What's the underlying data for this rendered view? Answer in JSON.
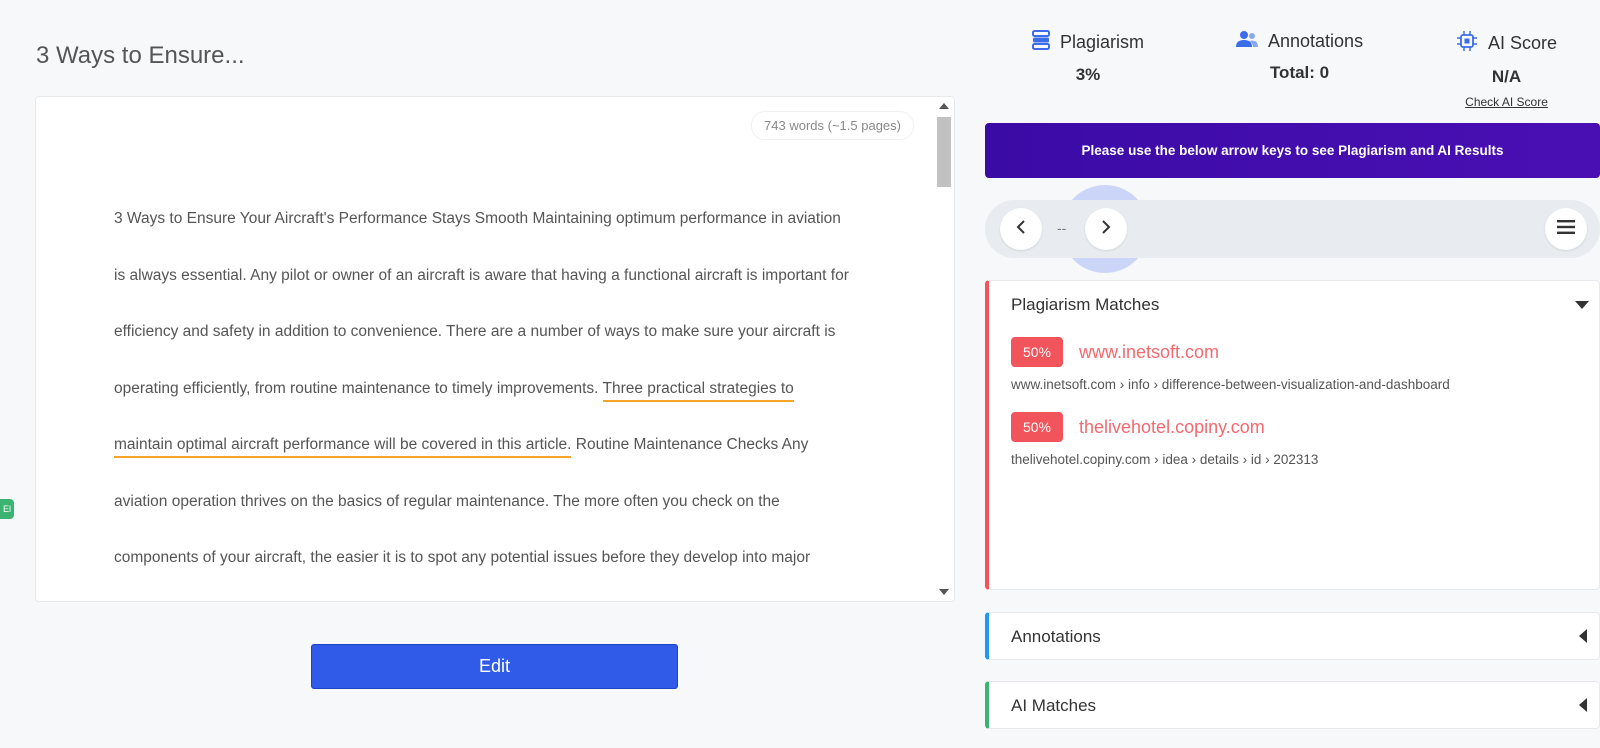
{
  "document": {
    "title": "3 Ways to Ensure...",
    "word_count": "743 words (~1.5 pages)",
    "text_before": "3 Ways to Ensure Your Aircraft's Performance Stays Smooth Maintaining optimum performance in aviation is always essential. Any pilot or owner of an aircraft is aware that having a functional aircraft is important for efficiency and safety in addition to convenience. There are a number of ways to make sure your aircraft is operating efficiently, from routine maintenance to timely improvements. ",
    "text_highlight": "Three practical strategies to maintain optimal aircraft performance will be covered in this article.",
    "text_after": " Routine Maintenance Checks Any aviation operation thrives on the basics of regular maintenance. The more often you check on the components of your aircraft, the easier it is to spot any potential issues before they develop into major problems. There are scheduled maintenance checks to be done in accordance with the manufacturer's",
    "highlight_color": "#f4a428"
  },
  "edit_button": {
    "label": "Edit",
    "color": "#2f5be8"
  },
  "side_tag": {
    "label": "El"
  },
  "stats": {
    "plagiarism": {
      "label": "Plagiarism",
      "value": "3%",
      "icon": "database-icon"
    },
    "annotations": {
      "label": "Annotations",
      "value": "Total: 0",
      "icon": "users-icon"
    },
    "ai_score": {
      "label": "AI Score",
      "value": "N/A",
      "link": "Check AI Score",
      "icon": "chip-icon"
    }
  },
  "banner": {
    "text": "Please use the below arrow keys to see Plagiarism and AI Results",
    "color": "#3b0ba6"
  },
  "navigator": {
    "index": "--",
    "prev_icon": "chevron-left-icon",
    "next_icon": "chevron-right-icon",
    "menu_icon": "hamburger-menu-icon"
  },
  "panels": {
    "plagiarism_matches": {
      "title": "Plagiarism Matches",
      "accent": "#f2545b",
      "matches": [
        {
          "percent": "50%",
          "site": "www.inetsoft.com",
          "path": "www.inetsoft.com › info › difference-between-visualization-and-dashboard"
        },
        {
          "percent": "50%",
          "site": "thelivehotel.copiny.com",
          "path": "thelivehotel.copiny.com › idea › details › id › 202313"
        }
      ]
    },
    "annotations": {
      "title": "Annotations",
      "accent": "#2196f3"
    },
    "ai_matches": {
      "title": "AI Matches",
      "accent": "#3cb371"
    }
  }
}
